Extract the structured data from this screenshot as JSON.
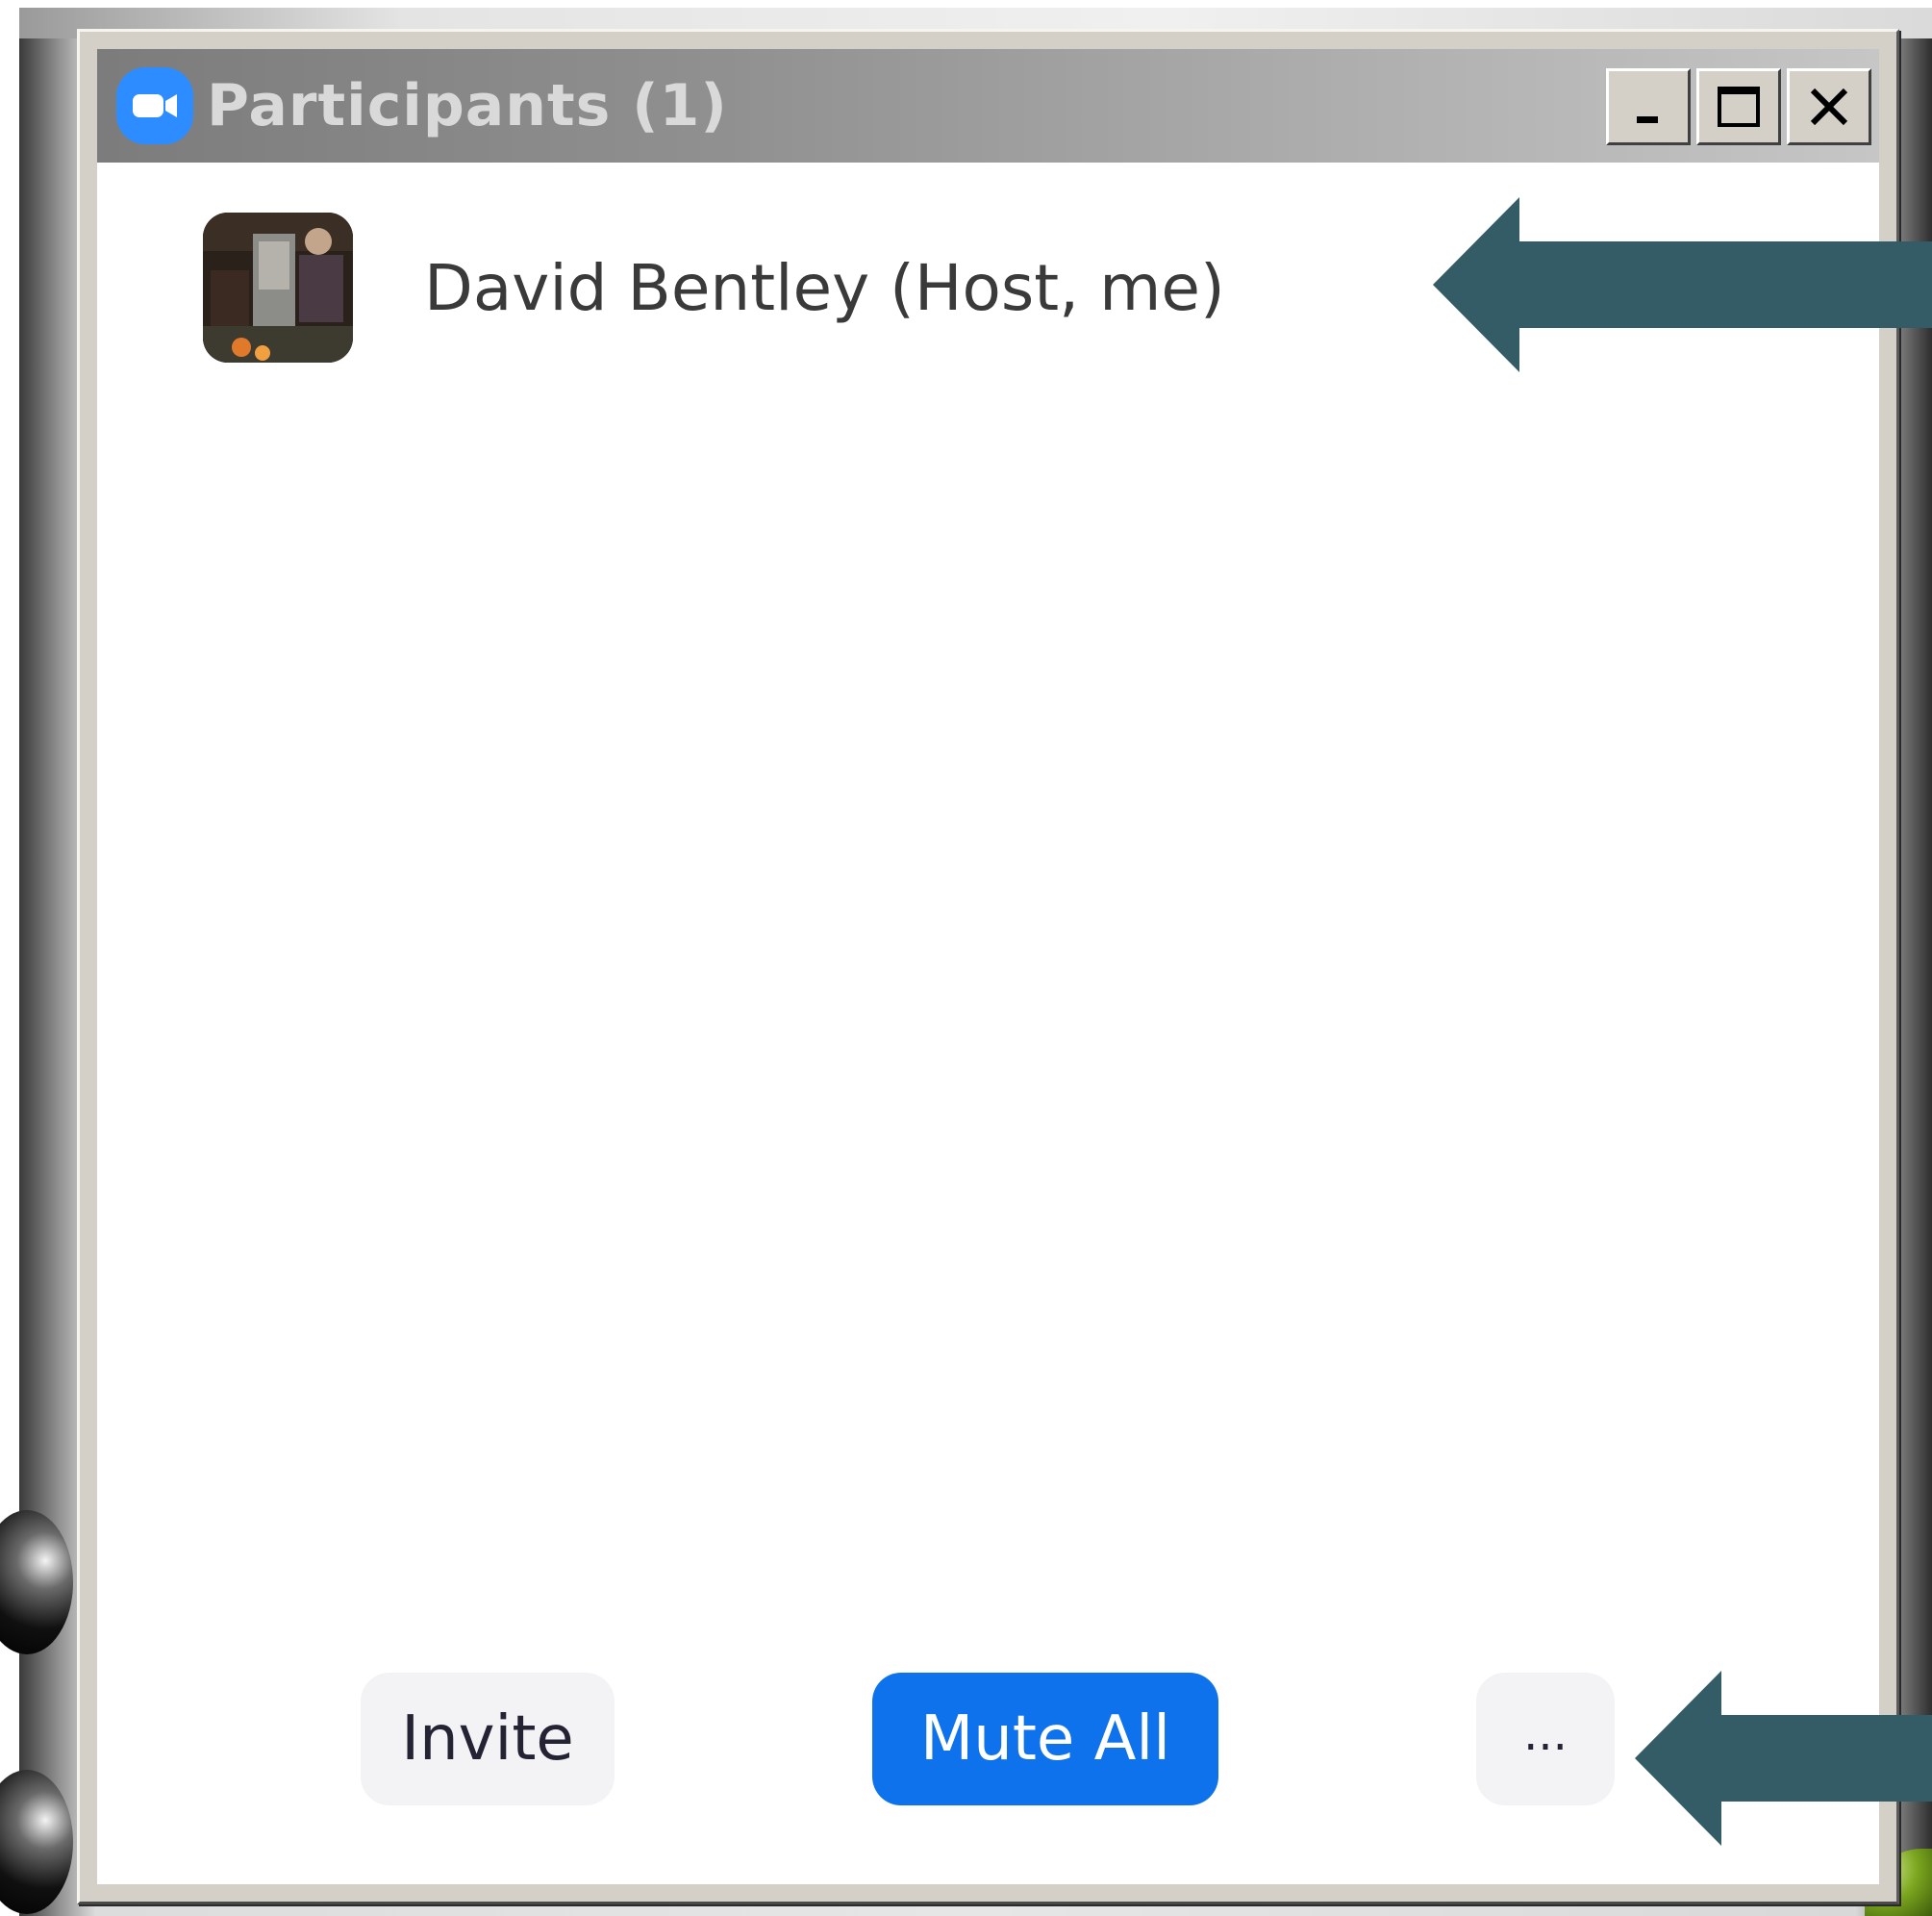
{
  "window": {
    "title": "Participants (1)",
    "icon": "zoom-camera-icon",
    "caption_buttons": [
      "minimize-icon",
      "maximize-icon",
      "close-icon"
    ]
  },
  "participants": [
    {
      "name": "David Bentley (Host, me)",
      "avatar": "photo-avatar"
    }
  ],
  "footer": {
    "invite_label": "Invite",
    "mute_all_label": "Mute All",
    "more_label": "..."
  },
  "annotations": {
    "arrow_icon": "left-arrow-icon",
    "arrow_color": "#335c67"
  },
  "colors": {
    "zoom_blue": "#2d8cff",
    "mute_all_blue": "#0e72ed",
    "button_gray": "#f3f3f6"
  }
}
